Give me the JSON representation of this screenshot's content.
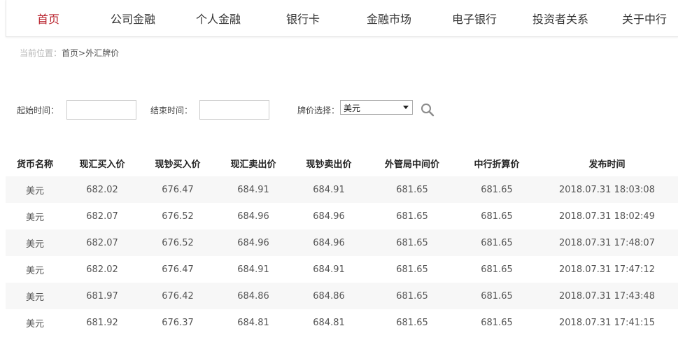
{
  "nav": {
    "items": [
      {
        "label": "首页",
        "active": true
      },
      {
        "label": "公司金融"
      },
      {
        "label": "个人金融"
      },
      {
        "label": "银行卡"
      },
      {
        "label": "金融市场"
      },
      {
        "label": "电子银行"
      },
      {
        "label": "投资者关系"
      },
      {
        "label": "关于中行"
      }
    ],
    "active_color": "#b8202b"
  },
  "breadcrumb": {
    "prefix": "当前位置：",
    "path": "首页>外汇牌价"
  },
  "filters": {
    "start_label": "起始时间：",
    "start_value": "",
    "end_label": "结束时间：",
    "end_value": "",
    "currency_label": "牌价选择：",
    "currency_selected": "美元",
    "search_icon": "search-icon"
  },
  "table": {
    "headers": [
      "货币名称",
      "现汇买入价",
      "现钞买入价",
      "现汇卖出价",
      "现钞卖出价",
      "外管局中间价",
      "中行折算价",
      "发布时间"
    ],
    "rows": [
      [
        "美元",
        "682.02",
        "676.47",
        "684.91",
        "684.91",
        "681.65",
        "681.65",
        "2018.07.31 18:03:08"
      ],
      [
        "美元",
        "682.07",
        "676.52",
        "684.96",
        "684.96",
        "681.65",
        "681.65",
        "2018.07.31 18:02:49"
      ],
      [
        "美元",
        "682.07",
        "676.52",
        "684.96",
        "684.96",
        "681.65",
        "681.65",
        "2018.07.31 17:48:07"
      ],
      [
        "美元",
        "682.02",
        "676.47",
        "684.91",
        "684.91",
        "681.65",
        "681.65",
        "2018.07.31 17:47:12"
      ],
      [
        "美元",
        "681.97",
        "676.42",
        "684.86",
        "684.86",
        "681.65",
        "681.65",
        "2018.07.31 17:43:48"
      ],
      [
        "美元",
        "681.92",
        "676.37",
        "684.81",
        "684.81",
        "681.65",
        "681.65",
        "2018.07.31 17:41:15"
      ]
    ]
  }
}
